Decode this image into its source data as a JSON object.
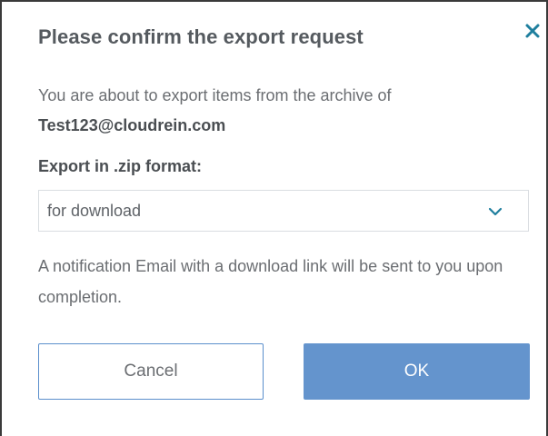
{
  "dialog": {
    "title": "Please confirm the export request",
    "message": "You are about to export items from the archive of",
    "email": "Test123@cloudrein.com",
    "format_label": "Export in .zip format:",
    "format_selected": "for download",
    "note": "A notification Email with a download link will be sent to you upon completion.",
    "cancel_label": "Cancel",
    "ok_label": "OK"
  },
  "icons": {
    "close": "close-icon",
    "dropdown": "chevron-down-icon"
  },
  "colors": {
    "accent": "#1f7f9e",
    "primary_button": "#6494cd",
    "cancel_border": "#5b8fcc",
    "title_text": "#555a5f",
    "body_text": "#6b6e72"
  }
}
